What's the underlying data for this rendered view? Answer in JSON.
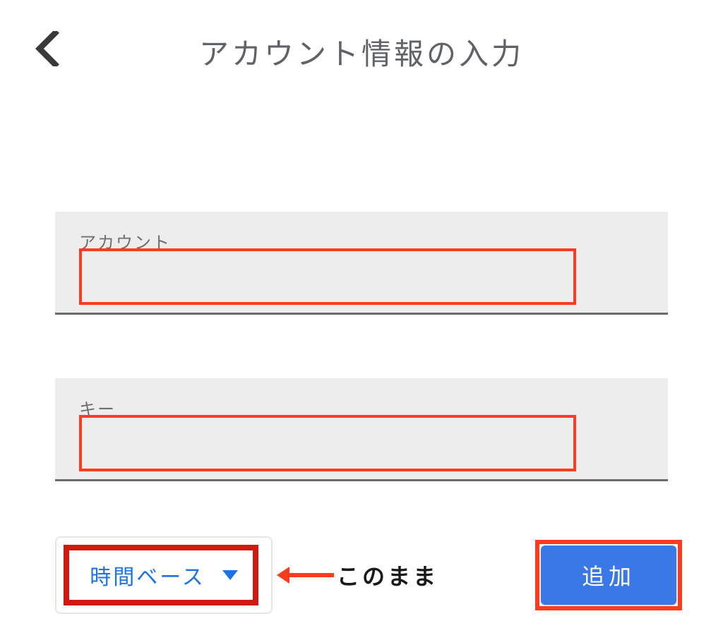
{
  "header": {
    "title": "アカウント情報の入力"
  },
  "fields": {
    "account": {
      "label": "アカウント",
      "value": ""
    },
    "key": {
      "label": "キー",
      "value": ""
    }
  },
  "dropdown": {
    "selected": "時間ベース"
  },
  "annotation": {
    "keep_as_is": "このまま"
  },
  "buttons": {
    "add": "追加"
  },
  "colors": {
    "highlight": "#ff3b1f",
    "primary": "#3b78e7",
    "link": "#1a73e8"
  }
}
